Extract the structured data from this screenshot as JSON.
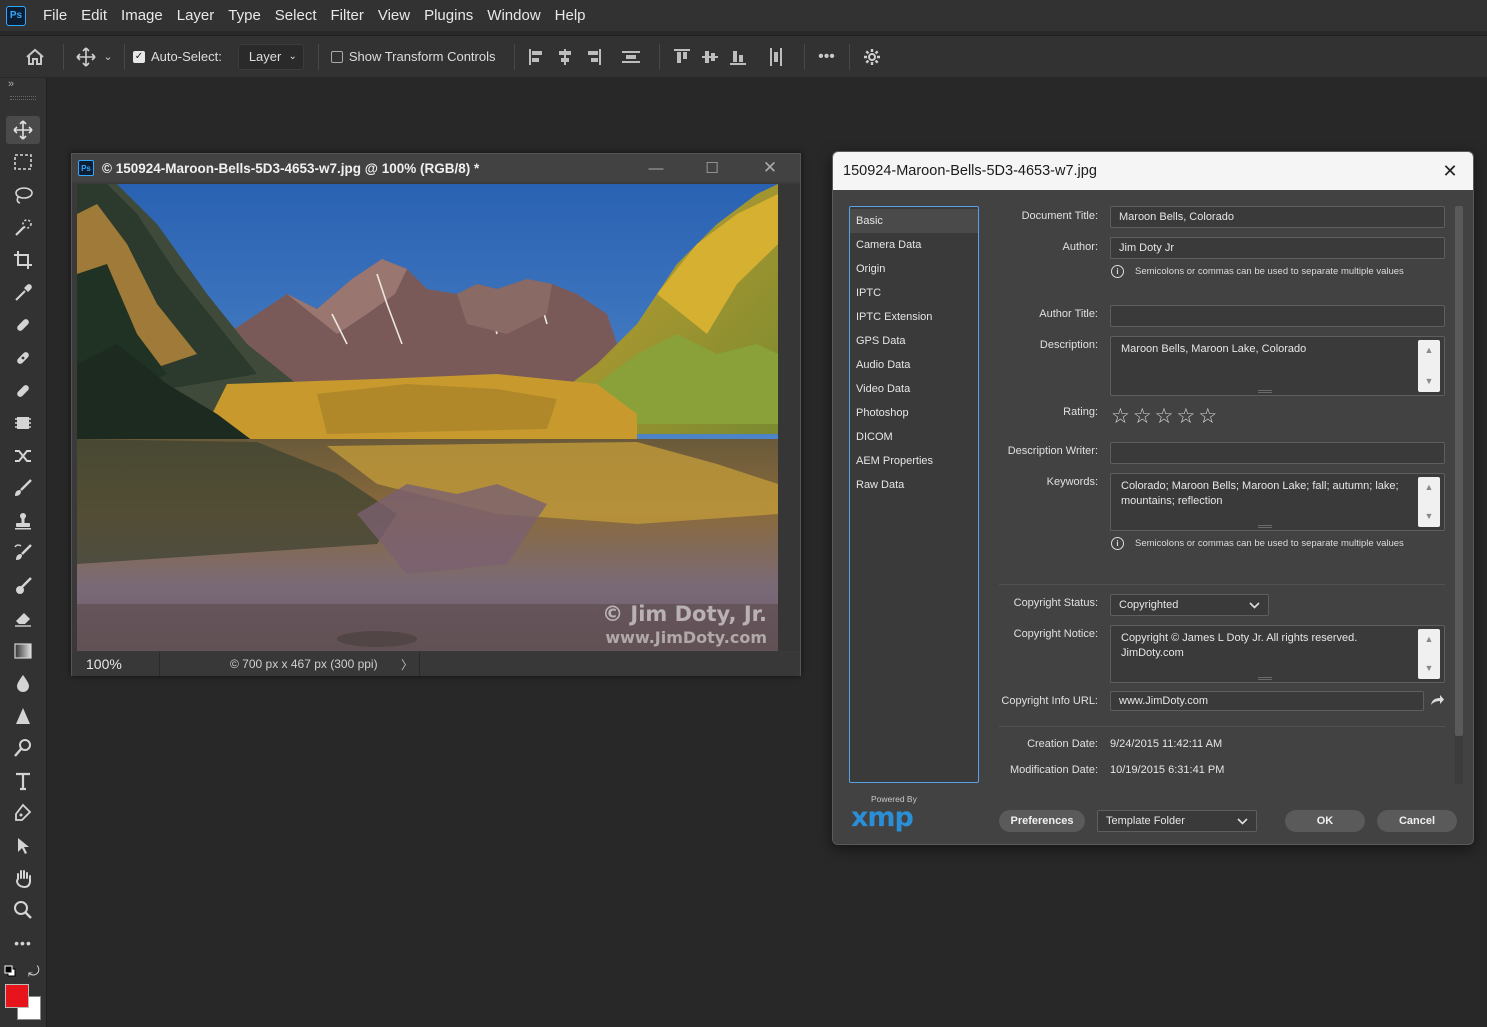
{
  "app": {
    "logo_text": "Ps",
    "menu": [
      "File",
      "Edit",
      "Image",
      "Layer",
      "Type",
      "Select",
      "Filter",
      "View",
      "Plugins",
      "Window",
      "Help"
    ]
  },
  "options_bar": {
    "auto_select_label": "Auto-Select:",
    "auto_select_checked": true,
    "layer_select_value": "Layer",
    "show_transform_label": "Show Transform Controls",
    "show_transform_checked": false
  },
  "document": {
    "title": "© 150924-Maroon-Bells-5D3-4653-w7.jpg @ 100% (RGB/8) *",
    "zoom": "100%",
    "info": "© 700 px x 467 px (300 ppi)",
    "watermark_line1": "© Jim Doty, Jr.",
    "watermark_line2": "www.JimDoty.com"
  },
  "dialog": {
    "title": "150924-Maroon-Bells-5D3-4653-w7.jpg",
    "categories": [
      "Basic",
      "Camera Data",
      "Origin",
      "IPTC",
      "IPTC Extension",
      "GPS Data",
      "Audio Data",
      "Video Data",
      "Photoshop",
      "DICOM",
      "AEM Properties",
      "Raw Data"
    ],
    "selected_category": "Basic",
    "fields": {
      "document_title_label": "Document Title:",
      "document_title_value": "Maroon Bells, Colorado",
      "author_label": "Author:",
      "author_value": "Jim Doty Jr",
      "author_hint": "Semicolons or commas can be used to separate multiple values",
      "author_title_label": "Author Title:",
      "author_title_value": "",
      "description_label": "Description:",
      "description_value": "Maroon Bells, Maroon Lake, Colorado",
      "rating_label": "Rating:",
      "rating_value": 0,
      "rating_max": 5,
      "description_writer_label": "Description Writer:",
      "description_writer_value": "",
      "keywords_label": "Keywords:",
      "keywords_value": "Colorado; Maroon Bells; Maroon Lake; fall; autumn; lake; mountains; reflection",
      "keywords_hint": "Semicolons or commas can be used to separate multiple values",
      "copyright_status_label": "Copyright Status:",
      "copyright_status_value": "Copyrighted",
      "copyright_notice_label": "Copyright Notice:",
      "copyright_notice_value": "Copyright © James L Doty Jr. All rights reserved. JimDoty.com",
      "copyright_url_label": "Copyright Info URL:",
      "copyright_url_value": "www.JimDoty.com",
      "creation_date_label": "Creation Date:",
      "creation_date_value": "9/24/2015 11:42:11 AM",
      "modification_date_label": "Modification Date:",
      "modification_date_value": "10/19/2015 6:31:41 PM"
    },
    "footer": {
      "powered_by": "Powered By",
      "xmp_logo": "xmp",
      "preferences_label": "Preferences",
      "template_folder_label": "Template Folder",
      "ok_label": "OK",
      "cancel_label": "Cancel"
    }
  },
  "colors": {
    "foreground_swatch": "#e8141c",
    "background_swatch": "#ffffff",
    "accent_blue": "#31a8ff",
    "xmp_blue": "#2a8fd6"
  }
}
